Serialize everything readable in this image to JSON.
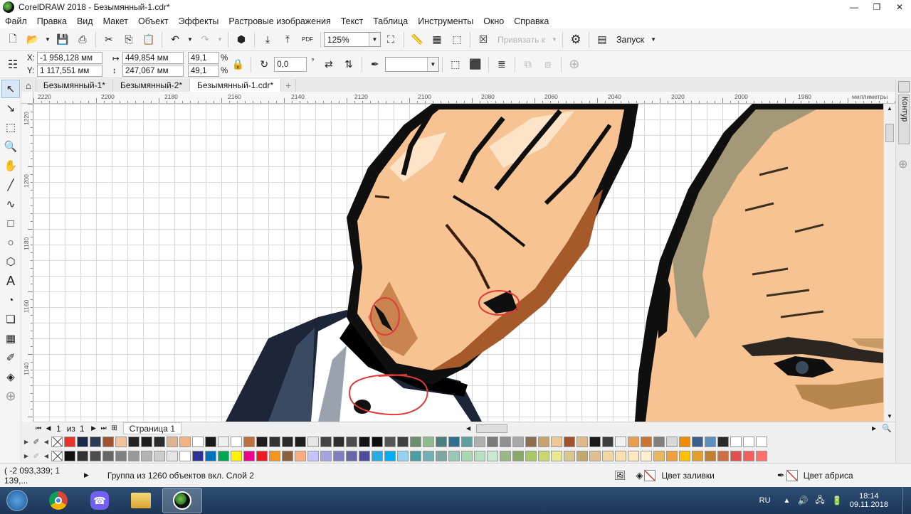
{
  "window": {
    "title": "CorelDRAW 2018 - Безымянный-1.cdr*",
    "controls": [
      "minimize",
      "restore",
      "close"
    ]
  },
  "menu": [
    "Файл",
    "Правка",
    "Вид",
    "Макет",
    "Объект",
    "Эффекты",
    "Растровые изображения",
    "Текст",
    "Таблица",
    "Инструменты",
    "Окно",
    "Справка"
  ],
  "toolbar1": {
    "zoom": "125%",
    "snap_label": "Привязать к",
    "launch_label": "Запуск"
  },
  "toolbar2": {
    "x": "-1 958,128 мм",
    "y": "1 117,551 мм",
    "width": "449,854 мм",
    "height": "247,067 мм",
    "scale_w": "49,1",
    "scale_h": "49,1",
    "percent": "%",
    "rotation": "0,0",
    "degree": "°",
    "x_label": "X:",
    "y_label": "Y:"
  },
  "doc_tabs": [
    "Безымянный-1*",
    "Безымянный-2*",
    "Безымянный-1.cdr*"
  ],
  "ruler": {
    "units": "миллиметры",
    "h_labels": [
      "2220",
      "2200",
      "2180",
      "2160",
      "2140",
      "2120",
      "2100",
      "2080",
      "2060",
      "2040",
      "2020",
      "2000",
      "1980"
    ],
    "v_labels": [
      "1220",
      "1200",
      "1180",
      "1160",
      "1140"
    ]
  },
  "page_nav": {
    "current": "1",
    "of": "из",
    "total": "1",
    "page_tab": "Страница 1"
  },
  "docker": {
    "tab": "Контур"
  },
  "palette_row1": [
    "#e5332a",
    "#1b2a4a",
    "#2d3a55",
    "#a0522d",
    "#f2c29b",
    "#222222",
    "#1e1e1e",
    "#2b2b2b",
    "#d9b48f",
    "#f4b183",
    "#ffffff",
    "#1a1a1a",
    "#f0f0f0",
    "#ffffff",
    "#c0703c",
    "#1c1c1c",
    "#333333",
    "#2a2a2a",
    "#1f1f1f",
    "#e6e6e6",
    "#444444",
    "#2e2e2e",
    "#4d4d4d",
    "#151515",
    "#0f0f0f",
    "#555555",
    "#3f3f3f",
    "#6b8e6b",
    "#8fbc8f",
    "#4a7f7f",
    "#2f6f8f",
    "#5f9ea0",
    "#b0b0b0",
    "#7a7a7a",
    "#909090",
    "#a8a8a8",
    "#8c6f4f",
    "#c8a26f",
    "#f0c896",
    "#a0522d",
    "#e0b98a",
    "#1a1a1a",
    "#3d3d3d",
    "#f2f2f2",
    "#e8a050",
    "#c87533",
    "#7f7f7f",
    "#d9d9d9",
    "#f08a00",
    "#3a5f8f",
    "#5c8fbf",
    "#2a2a2a",
    "#ffffff",
    "#ffffff",
    "#ffffff"
  ],
  "palette_row2": [
    "#111111",
    "#333333",
    "#4d4d4d",
    "#666666",
    "#808080",
    "#999999",
    "#b3b3b3",
    "#cccccc",
    "#e6e6e6",
    "#ffffff",
    "#2e3192",
    "#0072bc",
    "#00a651",
    "#fff200",
    "#ec008c",
    "#ed1c24",
    "#f7941d",
    "#8b5e3c",
    "#f9ad81",
    "#c4c4ff",
    "#a3a3e0",
    "#8080c0",
    "#6666aa",
    "#4d4d99",
    "#29abe2",
    "#00aeef",
    "#93d2f0",
    "#4d9fa0",
    "#71b1b1",
    "#7fa7a0",
    "#98c8b8",
    "#a8d8b0",
    "#b8e0c0",
    "#c8e8d0",
    "#98b888",
    "#88a868",
    "#a8c868",
    "#c8d870",
    "#e8e890",
    "#d8c890",
    "#c0a870",
    "#e0c090",
    "#f0d8a0",
    "#f8e0b0",
    "#ffe8c0",
    "#fff0d0",
    "#e8b860",
    "#f0a040",
    "#ffc000",
    "#e0a030",
    "#c08030",
    "#d07040",
    "#e05050",
    "#f06060",
    "#ff7070"
  ],
  "status": {
    "coords": "( -2 093,339; 1 139,...",
    "selection": "Группа из 1260 объектов вкл. Слой 2",
    "fill_label": "Цвет заливки",
    "outline_label": "Цвет абриса"
  },
  "taskbar": {
    "lang": "RU",
    "time": "18:14",
    "date": "09.11.2018"
  }
}
